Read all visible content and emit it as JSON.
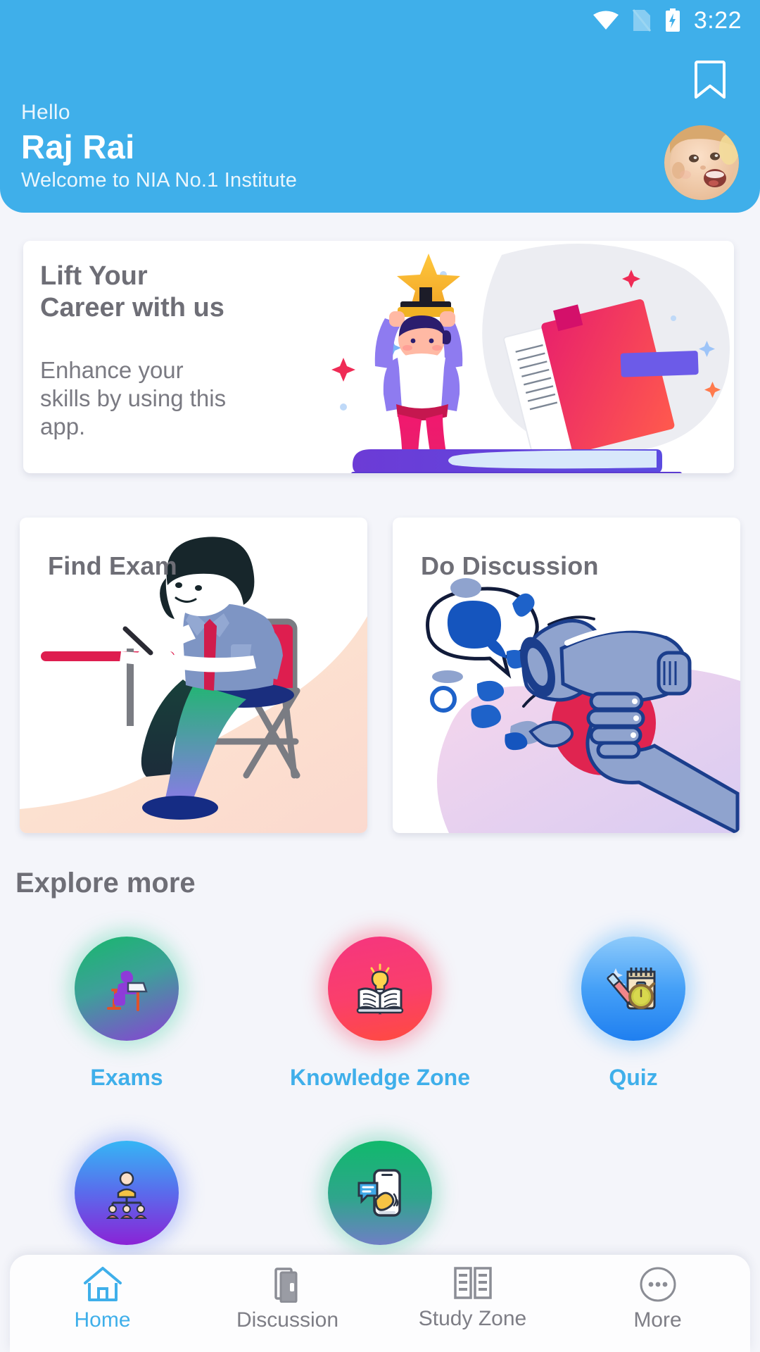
{
  "status_bar": {
    "time": "3:22",
    "icons": [
      "wifi-icon",
      "sim-off-icon",
      "battery-charging-icon"
    ]
  },
  "header": {
    "greeting": "Hello",
    "user_name": "Raj Rai",
    "welcome_text": "Welcome to NIA No.1 Institute",
    "bookmark_icon": "bookmark-icon",
    "avatar_icon": "avatar",
    "background_color": "#3FAFEA"
  },
  "banner": {
    "title": "Lift Your Career with us",
    "subtitle": "Enhance your skills by using this app.",
    "illustration": "person-lifting-trophy-illustration"
  },
  "feature_cards": [
    {
      "title": "Find Exam",
      "illustration": "student-writing-exam-illustration"
    },
    {
      "title": "Do Discussion",
      "illustration": "hand-holding-megaphone-illustration"
    }
  ],
  "explore": {
    "section_title": "Explore more",
    "items": [
      {
        "label": "Exams",
        "icon": "person-at-desk-icon",
        "color_start": "#17B86B",
        "color_end": "#8B3FD6"
      },
      {
        "label": "Knowledge Zone",
        "icon": "open-book-lightbulb-icon",
        "color_start": "#F5357F",
        "color_end": "#FF4B3E"
      },
      {
        "label": "Quiz",
        "icon": "notepad-stopwatch-icon",
        "color_start": "#7EC4FB",
        "color_end": "#1F7FF0"
      },
      {
        "label": "",
        "icon": "org-chart-icon",
        "color_start": "#35B6F5",
        "color_end": "#8A23D6"
      },
      {
        "label": "",
        "icon": "phone-notification-icon",
        "color_start": "#10B96C",
        "color_end": "#6F7FC5"
      }
    ],
    "label_color": "#3FAFEA"
  },
  "bottom_nav": {
    "active_index": 0,
    "active_color": "#3FAFEA",
    "inactive_color": "#7E7E86",
    "items": [
      {
        "label": "Home",
        "icon": "home-icon"
      },
      {
        "label": "Discussion",
        "icon": "book-stack-icon"
      },
      {
        "label": "Study Zone",
        "icon": "open-book-icon"
      },
      {
        "label": "More",
        "icon": "more-dots-icon"
      }
    ]
  },
  "theme": {
    "primary": "#3FAFEA",
    "page_background": "#F4F5FA",
    "card_background": "#FFFFFF",
    "heading_text": "#6E6E76"
  }
}
